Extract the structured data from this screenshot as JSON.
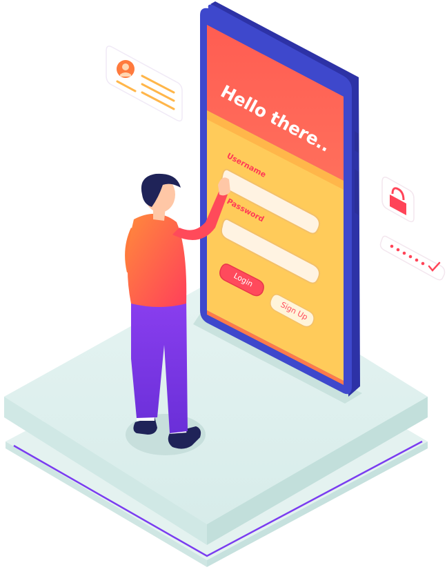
{
  "screen": {
    "title": "Hello there..",
    "username_label": "Username",
    "username_value": "",
    "password_label": "Password",
    "password_value": "",
    "login_label": "Login",
    "signup_label": "Sign Up"
  },
  "floating_cards": {
    "profile_card_icon": "user-profile-icon",
    "lock_card_icon": "lock-icon",
    "password_dots_icon": "password-check-icon"
  },
  "colors": {
    "phone_frame": "#3d46c8",
    "screen_top": "#ff5a55",
    "screen_body": "#ffcf5f",
    "accent_red": "#ff4458",
    "platform": "#dff1ef",
    "platform_edge": "#7a3cf0",
    "shirt": "#ff6a3a",
    "pants": "#7a3be0"
  }
}
